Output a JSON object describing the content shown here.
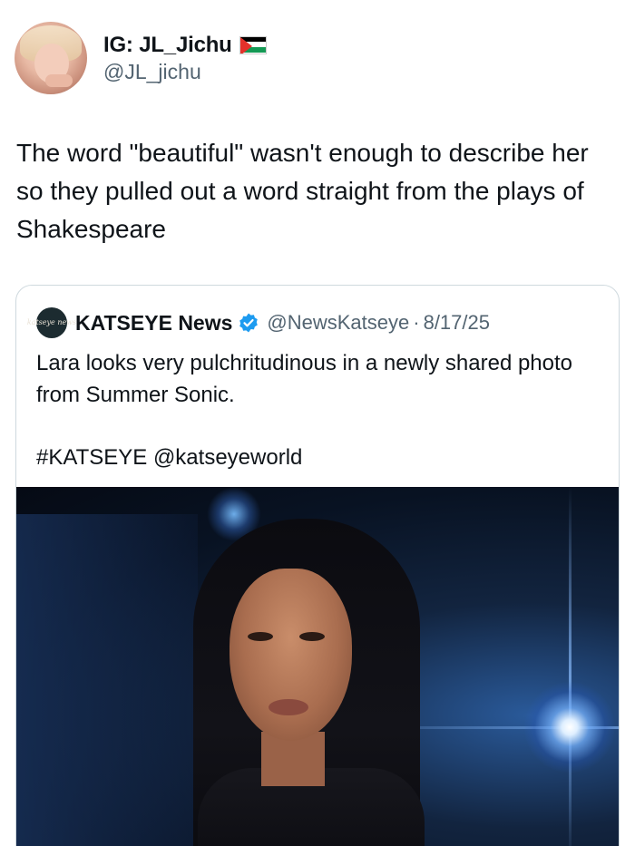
{
  "tweet": {
    "display_name": "IG: JL_Jichu",
    "handle": "@JL_jichu",
    "text": "The word \"beautiful\" wasn't enough to describe her so they pulled out a word straight from the plays of Shakespeare"
  },
  "quoted_tweet": {
    "avatar_text": "katseye news",
    "display_name": "KATSEYE News",
    "handle": "@NewsKatseye",
    "separator": "·",
    "date": "8/17/25",
    "text": "Lara looks very pulchritudinous in a newly shared photo from Summer Sonic.",
    "tags": "#KATSEYE @katseyeworld"
  },
  "colors": {
    "verified": "#1d9bf0",
    "secondary_text": "#536471",
    "border": "#cfd9de"
  },
  "icons": {
    "flag": "palestine-flag-icon",
    "verified": "verified-badge-icon"
  }
}
